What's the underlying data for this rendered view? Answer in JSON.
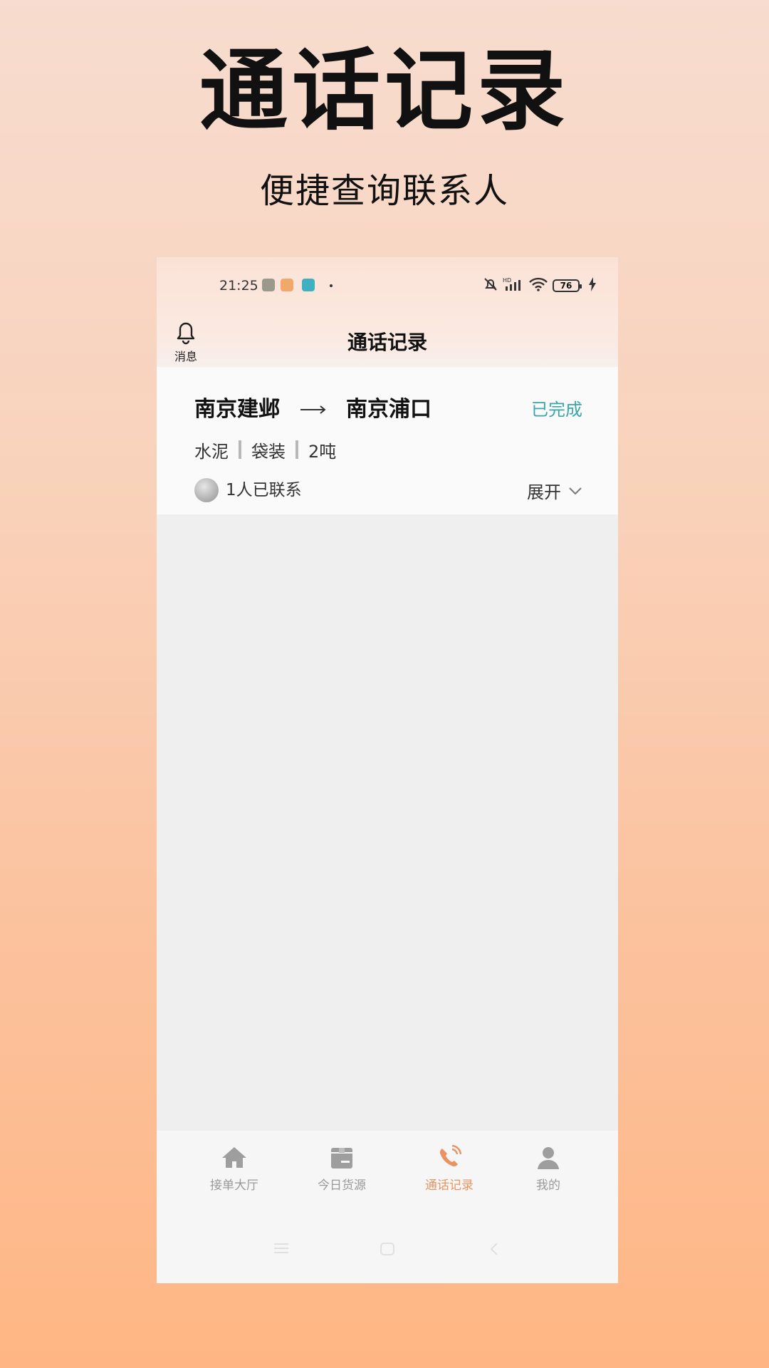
{
  "promo": {
    "title": "通话记录",
    "subtitle": "便捷查询联系人"
  },
  "status_bar": {
    "time": "21:25",
    "battery": "76",
    "icons": [
      "mute-bell-icon",
      "hd-signal-icon",
      "wifi-icon",
      "battery-icon",
      "charging-icon"
    ]
  },
  "header": {
    "message_label": "消息",
    "title": "通话记录"
  },
  "record": {
    "from": "南京建邺",
    "to": "南京浦口",
    "status": "已完成",
    "tags": [
      "水泥",
      "袋装",
      "2吨"
    ],
    "contact_summary": "1人已联系",
    "expand_label": "展开"
  },
  "tabs": [
    {
      "label": "接单大厅",
      "icon": "home-icon"
    },
    {
      "label": "今日货源",
      "icon": "package-icon"
    },
    {
      "label": "通话记录",
      "icon": "phone-call-icon",
      "active": true
    },
    {
      "label": "我的",
      "icon": "user-icon"
    }
  ],
  "colors": {
    "accent": "#e89462",
    "status_teal": "#3aa6ab"
  }
}
